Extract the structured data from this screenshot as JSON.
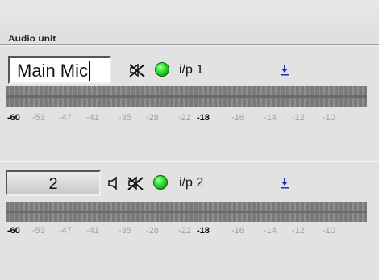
{
  "section_title": "Audio unit",
  "channels": [
    {
      "name": "Main Mic",
      "input_label": "i/p 1"
    },
    {
      "name": "2",
      "input_label": "i/p 2"
    }
  ],
  "scale_labels": [
    "-60",
    "-53",
    "-47",
    "-41",
    "-35",
    "-28",
    "-22",
    "-18",
    "-16",
    "-14",
    "-12",
    "-10"
  ],
  "scale_emphasis": [
    "-60",
    "-18"
  ],
  "icons": {
    "speaker": "speaker-icon",
    "mute": "speaker-muted-icon",
    "led": "status-led-icon",
    "dropdown": "dropdown-arrow-icon"
  },
  "colors": {
    "led": "#22c422",
    "dropdown": "#1a2fc4",
    "muted_scale": "#a0a0a0"
  }
}
